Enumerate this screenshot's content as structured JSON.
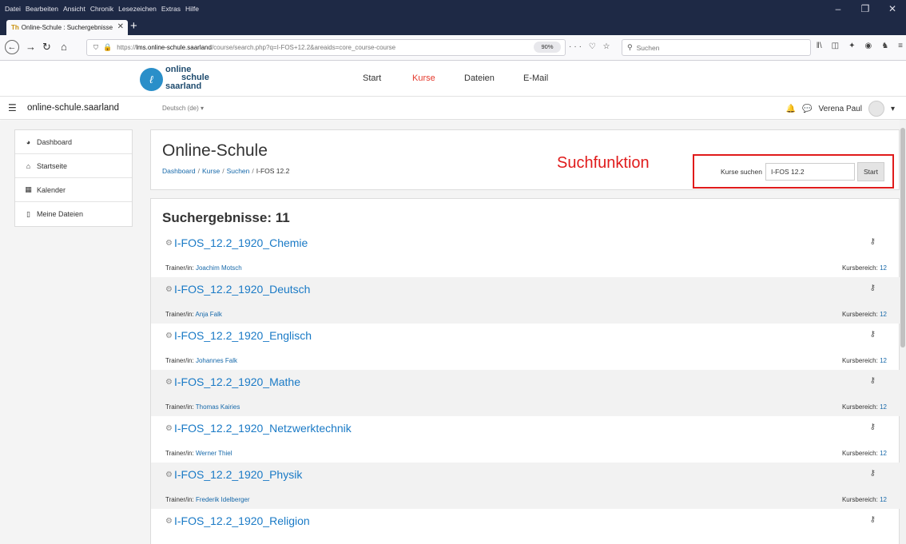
{
  "browser": {
    "menu": [
      "Datei",
      "Bearbeiten",
      "Ansicht",
      "Chronik",
      "Lesezeichen",
      "Extras",
      "Hilfe"
    ],
    "window_controls": [
      "–",
      "❐",
      "✕"
    ],
    "tab_title": "Online-Schule : Suchergebnisse",
    "url_prefix": "https://",
    "url_host": "lms.online-schule.saarland",
    "url_path": "/course/search.php?q=I-FOS+12.2&areaids=core_course-course",
    "zoom": "90%",
    "search_placeholder": "Suchen"
  },
  "site": {
    "logo_line1": "online",
    "logo_line2": "schule",
    "logo_line3": "saarland",
    "nav": [
      "Start",
      "Kurse",
      "Dateien",
      "E-Mail"
    ],
    "active_nav": "Kurse",
    "accent_color": "#e5392c",
    "sitename": "online-schule.saarland",
    "language": "Deutsch (de) ▾",
    "user_name": "Verena Paul"
  },
  "sidebar": {
    "items": [
      {
        "label": "Dashboard",
        "icon": "dashboard-icon"
      },
      {
        "label": "Startseite",
        "icon": "home-icon"
      },
      {
        "label": "Kalender",
        "icon": "calendar-icon"
      },
      {
        "label": "Meine Dateien",
        "icon": "file-icon"
      }
    ]
  },
  "header": {
    "title": "Online-Schule",
    "breadcrumb": [
      "Dashboard",
      "Kurse",
      "Suchen"
    ],
    "breadcrumb_current": "I-FOS 12.2",
    "annotation": "Suchfunktion",
    "annotation_color": "#e01b1b",
    "search_label": "Kurse suchen",
    "search_value": "I-FOS 12.2",
    "search_button": "Start"
  },
  "results": {
    "heading": "Suchergebnisse: 11",
    "trainer_label": "Trainer/in:",
    "bereich_label": "Kursbereich:",
    "items": [
      {
        "title": "I-FOS_12.2_1920_Chemie",
        "trainer": "Joachim Motsch",
        "bereich": "12"
      },
      {
        "title": "I-FOS_12.2_1920_Deutsch",
        "trainer": "Anja Falk",
        "bereich": "12"
      },
      {
        "title": "I-FOS_12.2_1920_Englisch",
        "trainer": "Johannes Falk",
        "bereich": "12"
      },
      {
        "title": "I-FOS_12.2_1920_Mathe",
        "trainer": "Thomas Kairies",
        "bereich": "12"
      },
      {
        "title": "I-FOS_12.2_1920_Netzwerktechnik",
        "trainer": "Werner Thiel",
        "bereich": "12"
      },
      {
        "title": "I-FOS_12.2_1920_Physik",
        "trainer": "Frederik Idelberger",
        "bereich": "12"
      },
      {
        "title": "I-FOS_12.2_1920_Religion",
        "trainer": "",
        "bereich": ""
      }
    ]
  }
}
